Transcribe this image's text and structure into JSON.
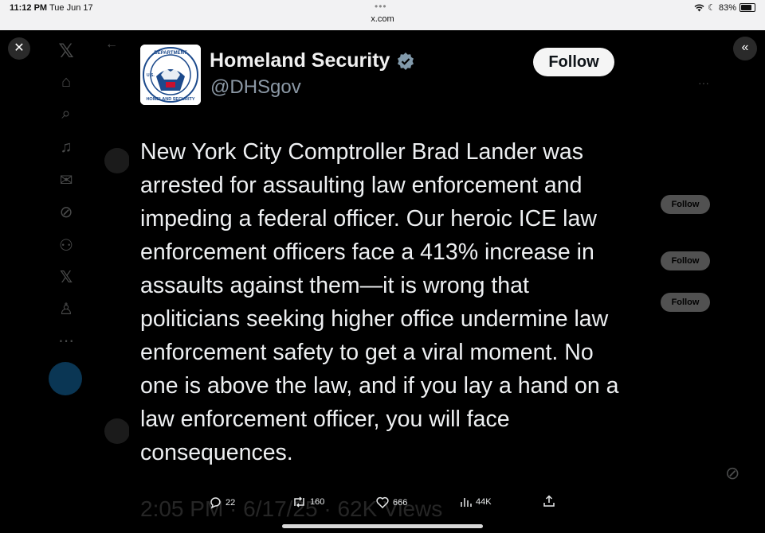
{
  "status_bar": {
    "time": "11:12 PM",
    "date": "Tue Jun 17",
    "url": "x.com",
    "battery": "83%"
  },
  "background": {
    "follow_labels": [
      "Follow",
      "Follow",
      "Follow"
    ],
    "footer": "2:05 PM · 6/17/25 · 62K Views"
  },
  "tweet": {
    "display_name": "Homeland Security",
    "handle": "@DHSgov",
    "verified": true,
    "follow_label": "Follow",
    "text": "New York City Comptroller Brad Lander was\narrested for assaulting law enforcement and\nimpeding a federal officer. Our heroic ICE law\nenforcement officers face a 413% increase in\nassaults against them—it is wrong that\npoliticians seeking higher office undermine law\nenforcement safety to get a viral moment. No\none is above the law, and if you lay a hand on a\nlaw enforcement officer, you will face\nconsequences.",
    "logo_text": [
      "DEPARTMENT",
      "HOMELAND SECURITY",
      "U.S."
    ]
  },
  "actions": {
    "replies": "22",
    "reposts": "160",
    "likes": "666",
    "views": "44K"
  },
  "colors": {
    "verified_badge": "#829aab",
    "seal_blue": "#1c4a8c",
    "handle": "#8b98a5"
  }
}
